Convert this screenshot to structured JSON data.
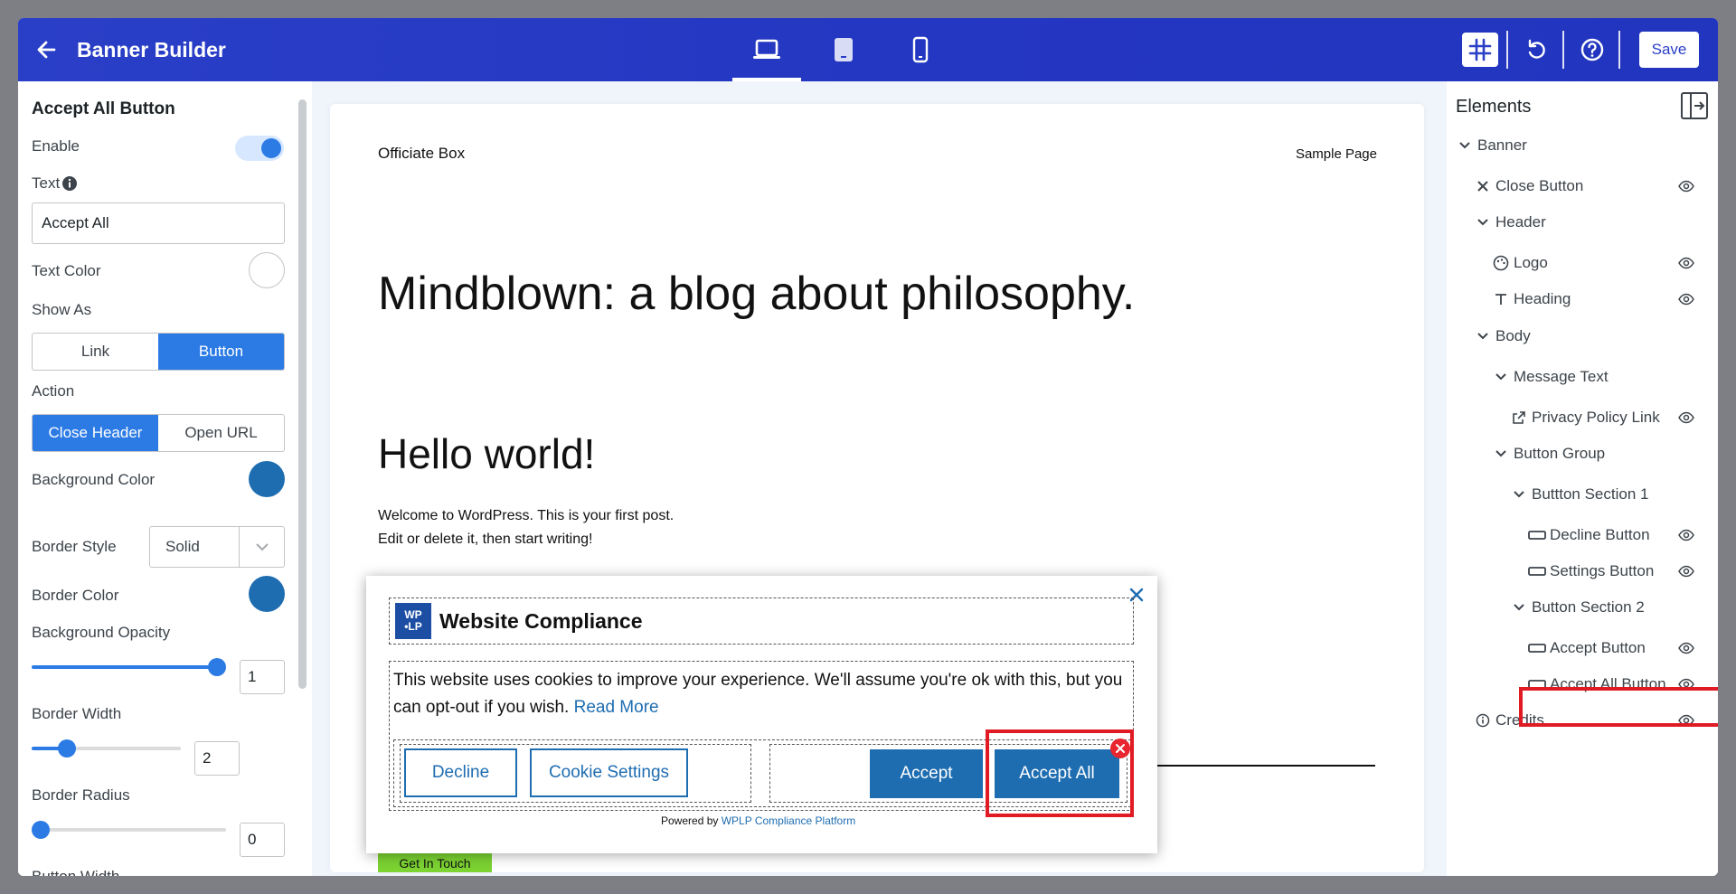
{
  "header": {
    "title": "Banner Builder",
    "devices": [
      "desktop-icon",
      "tablet-icon",
      "mobile-icon"
    ],
    "active_device": "desktop",
    "save_label": "Save"
  },
  "left_panel": {
    "title": "Accept All Button",
    "enable_label": "Enable",
    "enable_on": true,
    "text_label": "Text",
    "text_value": "Accept All",
    "text_color_label": "Text Color",
    "text_color": "#ffffff",
    "show_as_label": "Show As",
    "show_as_options": [
      "Link",
      "Button"
    ],
    "show_as_selected": "Button",
    "action_label": "Action",
    "action_options": [
      "Close Header",
      "Open URL"
    ],
    "action_selected": "Close Header",
    "bg_color_label": "Background Color",
    "bg_color": "#1e6db1",
    "border_style_label": "Border Style",
    "border_style_value": "Solid",
    "border_color_label": "Border Color",
    "border_color": "#1e6db1",
    "bg_opacity_label": "Background Opacity",
    "bg_opacity_value": "1",
    "border_width_label": "Border Width",
    "border_width_value": "2",
    "border_radius_label": "Border Radius",
    "border_radius_value": "0",
    "button_width_label": "Button Width"
  },
  "preview": {
    "site_title": "Officiate Box",
    "nav_link": "Sample Page",
    "headline": "Mindblown: a blog about philosophy.",
    "post_title": "Hello world!",
    "post_line1": "Welcome to WordPress. This is your first post.",
    "post_line2": "Edit or delete it, then start writing!",
    "cta_label": "Get In Touch"
  },
  "banner": {
    "logo_line1": "WP",
    "logo_line2": "•LP",
    "title": "Website Compliance",
    "message": "This website uses cookies to improve your experience. We'll assume you're ok with this, but you can opt-out if you wish.",
    "read_more": "Read More",
    "decline_label": "Decline",
    "settings_label": "Cookie Settings",
    "accept_label": "Accept",
    "accept_all_label": "Accept All",
    "powered_prefix": "Powered by",
    "powered_link": "WPLP Compliance Platform",
    "button_color": "#1e6db1"
  },
  "elements_panel": {
    "title": "Elements",
    "tree": [
      {
        "label": "Banner",
        "icon": "chevron-down-icon",
        "eye": false
      },
      {
        "label": "Close Button",
        "icon": "close-icon",
        "eye": true
      },
      {
        "label": "Header",
        "icon": "chevron-down-icon",
        "eye": false
      },
      {
        "label": "Logo",
        "icon": "palette-icon",
        "eye": true
      },
      {
        "label": "Heading",
        "icon": "text-icon",
        "eye": true
      },
      {
        "label": "Body",
        "icon": "chevron-down-icon",
        "eye": false
      },
      {
        "label": "Message Text",
        "icon": "chevron-down-icon",
        "eye": false
      },
      {
        "label": "Privacy Policy Link",
        "icon": "external-link-icon",
        "eye": true
      },
      {
        "label": "Button Group",
        "icon": "chevron-down-icon",
        "eye": false
      },
      {
        "label": "Buttton Section 1",
        "icon": "chevron-down-icon",
        "eye": false
      },
      {
        "label": "Decline Button",
        "icon": "button-icon",
        "eye": true
      },
      {
        "label": "Settings Button",
        "icon": "button-icon",
        "eye": true
      },
      {
        "label": "Button Section 2",
        "icon": "chevron-down-icon",
        "eye": false
      },
      {
        "label": "Accept Button",
        "icon": "button-icon",
        "eye": true
      },
      {
        "label": "Accept All Button",
        "icon": "button-icon",
        "eye": true,
        "selected": true
      },
      {
        "label": "Credits",
        "icon": "info-icon",
        "eye": true
      }
    ]
  }
}
